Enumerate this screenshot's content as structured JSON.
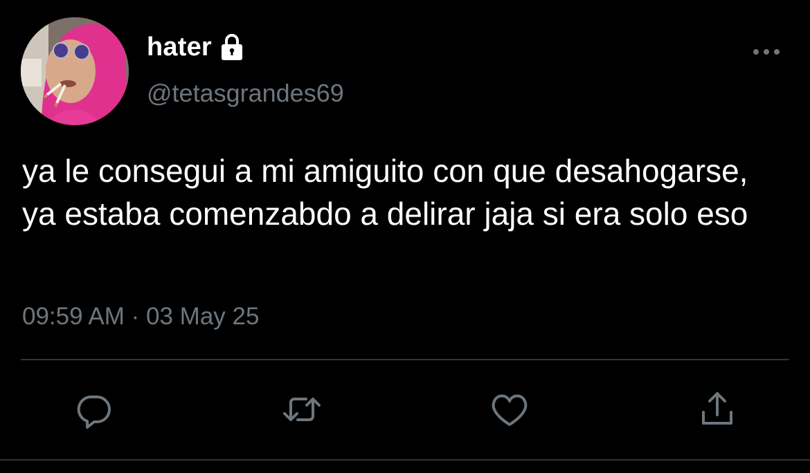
{
  "user": {
    "display_name": "hater",
    "handle": "@tetasgrandes69",
    "avatar_icon": "avatar-image",
    "protected_icon": "lock-icon"
  },
  "tweet": {
    "text": "ya le consegui a mi amiguito con que desahogarse, ya estaba comenzabdo a delirar jaja si era solo eso",
    "time": "09:59 AM",
    "separator": "·",
    "date": "03 May 25"
  },
  "actions": [
    {
      "name": "reply",
      "icon": "reply-icon"
    },
    {
      "name": "retweet",
      "icon": "retweet-icon"
    },
    {
      "name": "like",
      "icon": "heart-icon"
    },
    {
      "name": "share",
      "icon": "share-icon"
    }
  ],
  "colors": {
    "background": "#000000",
    "text_primary": "#ffffff",
    "text_secondary": "#6e767d",
    "divider": "#2f3336",
    "icon": "#6e767d"
  }
}
